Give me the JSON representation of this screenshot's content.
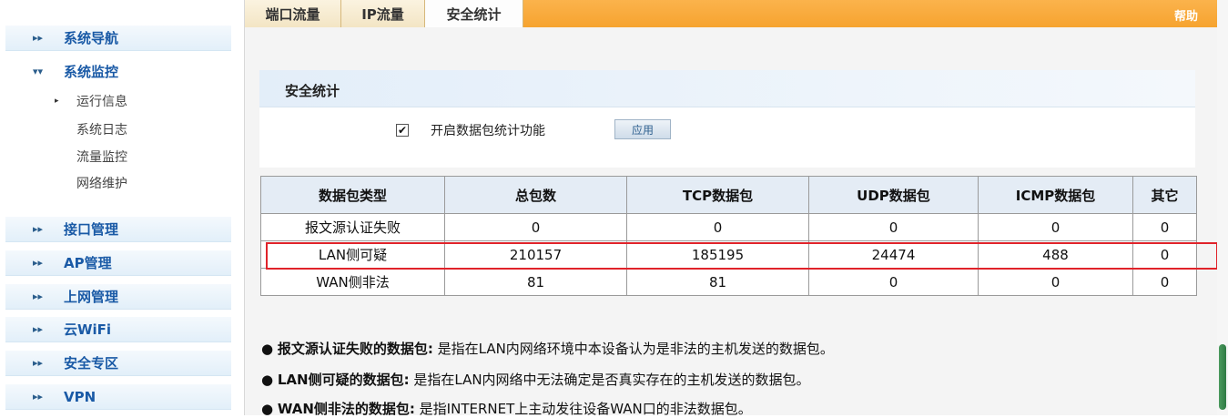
{
  "sidebar": {
    "items": [
      {
        "label": "系统导航"
      },
      {
        "label": "系统监控"
      },
      {
        "label": "接口管理"
      },
      {
        "label": "AP管理"
      },
      {
        "label": "上网管理"
      },
      {
        "label": "云WiFi"
      },
      {
        "label": "安全专区"
      },
      {
        "label": "VPN"
      }
    ],
    "monitor_subitems": [
      {
        "label": "运行信息"
      },
      {
        "label": "系统日志"
      },
      {
        "label": "流量监控"
      },
      {
        "label": "网络维护"
      }
    ]
  },
  "tabs": [
    {
      "label": "端口流量"
    },
    {
      "label": "IP流量"
    },
    {
      "label": "安全统计"
    }
  ],
  "help_label": "帮助",
  "section": {
    "title": "安全统计",
    "checkbox_label": "开启数据包统计功能",
    "checkbox_checked": true,
    "apply_label": "应用"
  },
  "table": {
    "headers": [
      "数据包类型",
      "总包数",
      "TCP数据包",
      "UDP数据包",
      "ICMP数据包",
      "其它"
    ],
    "rows": [
      [
        "报文源认证失败",
        "0",
        "0",
        "0",
        "0",
        "0"
      ],
      [
        "LAN侧可疑",
        "210157",
        "185195",
        "24474",
        "488",
        "0"
      ],
      [
        "WAN侧非法",
        "81",
        "81",
        "0",
        "0",
        "0"
      ]
    ]
  },
  "notes": [
    {
      "term": "报文源认证失败的数据包:",
      "desc": " 是指在LAN内网络环境中本设备认为是非法的主机发送的数据包。"
    },
    {
      "term": "LAN侧可疑的数据包:",
      "desc": " 是指在LAN内网络中无法确定是否真实存在的主机发送的数据包。"
    },
    {
      "term": "WAN侧非法的数据包:",
      "desc": " 是指INTERNET上主动发往设备WAN口的非法数据包。"
    }
  ],
  "icons": {
    "collapsed_arrow": "chevron-right-icon",
    "expanded_arrow": "chevron-down-icon",
    "bullet": "bullet-icon"
  },
  "colors": {
    "tab_bar": "#f6a32f",
    "nav_text": "#1a5aa6",
    "highlight": "#e0232a",
    "scroll_thumb": "#2e7a44"
  }
}
